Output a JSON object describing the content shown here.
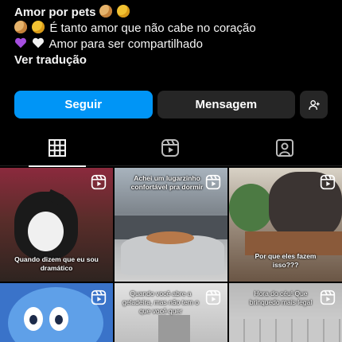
{
  "bio": {
    "name_line": "Amor por pets",
    "line2": "É tanto amor que não cabe no coração",
    "line3": "Amor para ser compartilhado",
    "translate": "Ver tradução"
  },
  "actions": {
    "follow": "Seguir",
    "message": "Mensagem"
  },
  "tabs": [
    "posts-grid-icon",
    "reels-icon",
    "tagged-icon"
  ],
  "posts": [
    {
      "caption": "Quando dizem que eu sou dramático"
    },
    {
      "caption": "Achei um lugarzinho confortável pra dormir"
    },
    {
      "caption": "Por que eles fazem isso???"
    },
    {
      "caption": ""
    },
    {
      "caption": "Quando você abre a geladeira, mas não tem o que você quer"
    },
    {
      "caption": "Hora do céu! Que brinquedo mais legal"
    }
  ],
  "colors": {
    "accent": "#0095f6",
    "surface": "#262626",
    "background": "#000000"
  }
}
